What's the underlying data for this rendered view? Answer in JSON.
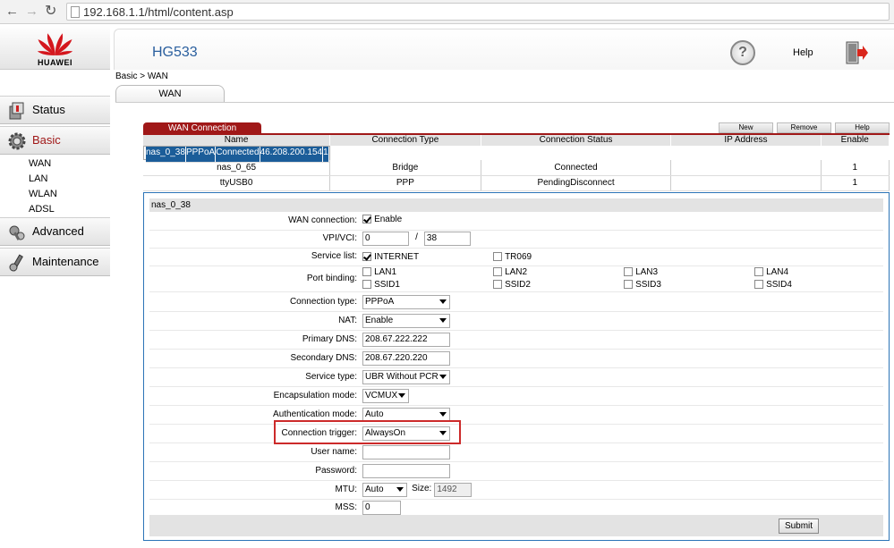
{
  "browser": {
    "url": "192.168.1.1/html/content.asp"
  },
  "brand": {
    "name": "HUAWEI",
    "model": "HG533",
    "accent": "#a01818"
  },
  "header": {
    "help_label": "Help"
  },
  "sidebar": {
    "status": "Status",
    "basic": "Basic",
    "basic_items": [
      "WAN",
      "LAN",
      "WLAN",
      "ADSL"
    ],
    "advanced": "Advanced",
    "maintenance": "Maintenance"
  },
  "breadcrumb": "Basic > WAN",
  "tab": "WAN",
  "wan": {
    "title": "WAN Connection",
    "buttons": {
      "new": "New",
      "remove": "Remove",
      "help": "Help"
    },
    "columns": [
      "Name",
      "Connection Type",
      "Connection Status",
      "IP Address",
      "Enable"
    ],
    "rows": [
      {
        "name": "nas_0_38",
        "type": "PPPoA",
        "status": "Connected",
        "ip": "46.208.200.154",
        "enable": "1"
      },
      {
        "name": "nas_0_65",
        "type": "Bridge",
        "status": "Connected",
        "ip": "",
        "enable": "1"
      },
      {
        "name": "ttyUSB0",
        "type": "PPP",
        "status": "PendingDisconnect",
        "ip": "",
        "enable": "1"
      }
    ]
  },
  "detail": {
    "title": "nas_0_38",
    "wan_connection_label": "WAN connection:",
    "enable_label": "Enable",
    "vpivci_label": "VPI/VCI:",
    "vpi": "0",
    "vci_sep": "/",
    "vci": "38",
    "service_list_label": "Service list:",
    "internet_label": "INTERNET",
    "tr069_label": "TR069",
    "port_binding_label": "Port binding:",
    "ports": [
      "LAN1",
      "LAN2",
      "LAN3",
      "LAN4",
      "SSID1",
      "SSID2",
      "SSID3",
      "SSID4"
    ],
    "connection_type_label": "Connection type:",
    "connection_type": "PPPoA",
    "nat_label": "NAT:",
    "nat": "Enable",
    "primary_dns_label": "Primary DNS:",
    "primary_dns": "208.67.222.222",
    "secondary_dns_label": "Secondary DNS:",
    "secondary_dns": "208.67.220.220",
    "service_type_label": "Service type:",
    "service_type": "UBR Without PCR",
    "encapsulation_label": "Encapsulation mode:",
    "encapsulation": "VCMUX",
    "auth_label": "Authentication mode:",
    "auth": "Auto",
    "trigger_label": "Connection trigger:",
    "trigger": "AlwaysOn",
    "username_label": "User name:",
    "username": "",
    "password_label": "Password:",
    "password": "",
    "mtu_label": "MTU:",
    "mtu": "Auto",
    "size_label": "Size:",
    "size": "1492",
    "mss_label": "MSS:",
    "mss": "0",
    "submit": "Submit"
  }
}
